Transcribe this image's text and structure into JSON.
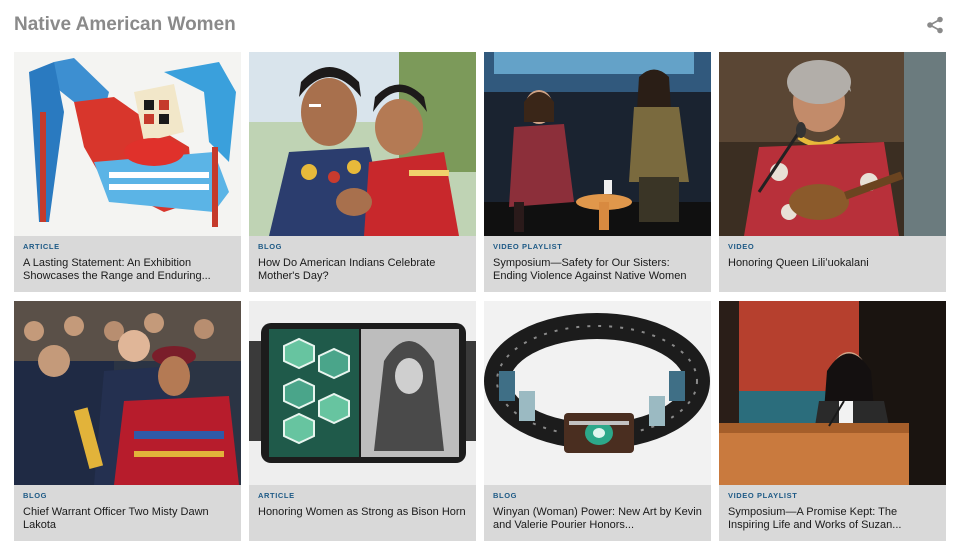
{
  "header": {
    "title": "Native American Women",
    "share_icon": "share-icon"
  },
  "cards": [
    {
      "type": "ARTICLE",
      "title": "A Lasting Statement: An Exhibition Showcases the Range and Enduring..."
    },
    {
      "type": "BLOG",
      "title": "How Do American Indians Celebrate Mother's Day?"
    },
    {
      "type": "VIDEO PLAYLIST",
      "title": "Symposium—Safety for Our Sisters: Ending Violence Against Native Women"
    },
    {
      "type": "VIDEO",
      "title": "Honoring Queen Liliʻuokalani"
    },
    {
      "type": "BLOG",
      "title": "Chief Warrant Officer Two Misty Dawn Lakota"
    },
    {
      "type": "ARTICLE",
      "title": "Honoring Women as Strong as Bison Horn"
    },
    {
      "type": "BLOG",
      "title": "Winyan (Woman) Power: New Art by Kevin and Valerie Pourier Honors..."
    },
    {
      "type": "VIDEO PLAYLIST",
      "title": "Symposium—A Promise Kept: The Inspiring Life and Works of Suzan..."
    }
  ],
  "colors": {
    "title_gray": "#8a8a8a",
    "card_bg": "#d9d9d9",
    "type_label": "#1e5a86"
  }
}
